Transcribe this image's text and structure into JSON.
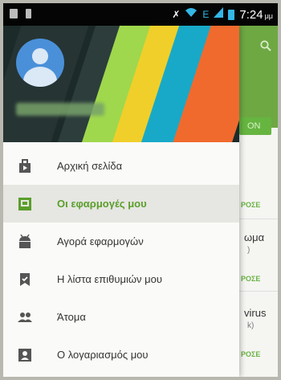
{
  "status_bar": {
    "time": "7:24",
    "ampm": "μμ",
    "network": "E"
  },
  "background_app": {
    "button": "ON",
    "price_label": "ΡΟΣΕ",
    "item_fragment_1": "ωμα",
    "item_fragment_1_sub": ")",
    "item_fragment_2": "virus",
    "item_fragment_2_sub": "k)"
  },
  "drawer": {
    "items": [
      {
        "label": "Αρχική σελίδα",
        "icon": "shop-bag-icon",
        "active": false
      },
      {
        "label": "Οι εφαρμογές μου",
        "icon": "my-apps-icon",
        "active": true
      },
      {
        "label": "Αγορά εφαρμογών",
        "icon": "android-icon",
        "active": false
      },
      {
        "label": "Η λίστα επιθυμιών μου",
        "icon": "wishlist-bookmark-icon",
        "active": false
      },
      {
        "label": "Άτομα",
        "icon": "people-icon",
        "active": false
      },
      {
        "label": "Ο λογαριασμός μου",
        "icon": "account-icon",
        "active": false
      }
    ]
  },
  "colors": {
    "accent_green": "#5a9e2a",
    "status_blue": "#34b6e6"
  }
}
